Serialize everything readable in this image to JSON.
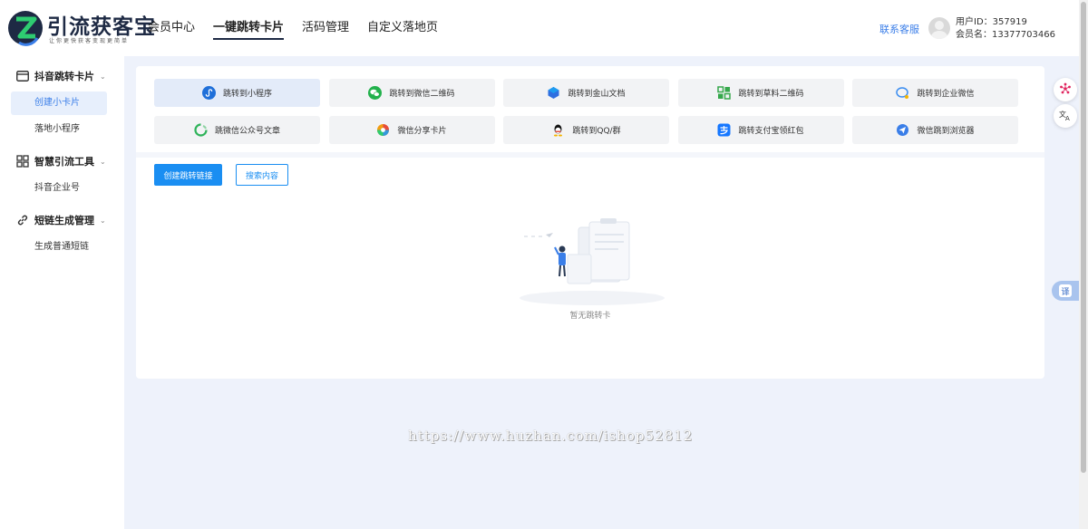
{
  "brand": {
    "title": "引流获客宝",
    "subtitle": "让你更快获客变现更简单"
  },
  "topnav": {
    "items": [
      {
        "label": "会员中心"
      },
      {
        "label": "一键跳转卡片"
      },
      {
        "label": "活码管理"
      },
      {
        "label": "自定义落地页"
      }
    ],
    "active": "一键跳转卡片"
  },
  "header": {
    "service_label": "联系客服",
    "user_id": "用户ID：357919",
    "member_name": "会员名：13377703466"
  },
  "sidebar": {
    "groups": [
      {
        "label": "抖音跳转卡片",
        "icon": "card-icon",
        "items": [
          {
            "label": "创建小卡片",
            "active": true
          },
          {
            "label": "落地小程序"
          }
        ]
      },
      {
        "label": "智慧引流工具",
        "icon": "grid-icon",
        "items": [
          {
            "label": "抖音企业号"
          }
        ]
      },
      {
        "label": "短链生成管理",
        "icon": "link-icon",
        "items": [
          {
            "label": "生成普通短链"
          }
        ]
      }
    ]
  },
  "card_types": [
    {
      "label": "跳转到小程序",
      "icon": "miniprogram-icon",
      "color": "#1f6fd9"
    },
    {
      "label": "跳转到微信二维码",
      "icon": "wechat-icon",
      "color": "#22b14c"
    },
    {
      "label": "跳转到金山文档",
      "icon": "kdocs-icon",
      "color": "#2f6fe0"
    },
    {
      "label": "跳转到草料二维码",
      "icon": "qrcode-icon",
      "color": "#35a84b"
    },
    {
      "label": "跳转到企业微信",
      "icon": "wecom-icon",
      "color": "#3b8df0"
    },
    {
      "label": "跳微信公众号文章",
      "icon": "official-account-icon",
      "color": "#2fb35a"
    },
    {
      "label": "微信分享卡片",
      "icon": "share-card-icon",
      "color": "#f39c12"
    },
    {
      "label": "跳转到QQ/群",
      "icon": "qq-icon",
      "color": "#111111"
    },
    {
      "label": "跳转支付宝领红包",
      "icon": "alipay-icon",
      "color": "#1677ff"
    },
    {
      "label": "微信跳到浏览器",
      "icon": "browser-icon",
      "color": "#3a7ee8"
    }
  ],
  "actions": {
    "create_label": "创建跳转链接",
    "search_label": "搜索内容"
  },
  "empty": {
    "text": "暂无跳转卡"
  },
  "watermark": "https://www.huzhan.com/ishop52812",
  "floating": {
    "translate_label": "译"
  },
  "colors": {
    "primary": "#1a8ef2",
    "brand_dark": "#1e2a44",
    "page_bg": "#eef2fb"
  }
}
